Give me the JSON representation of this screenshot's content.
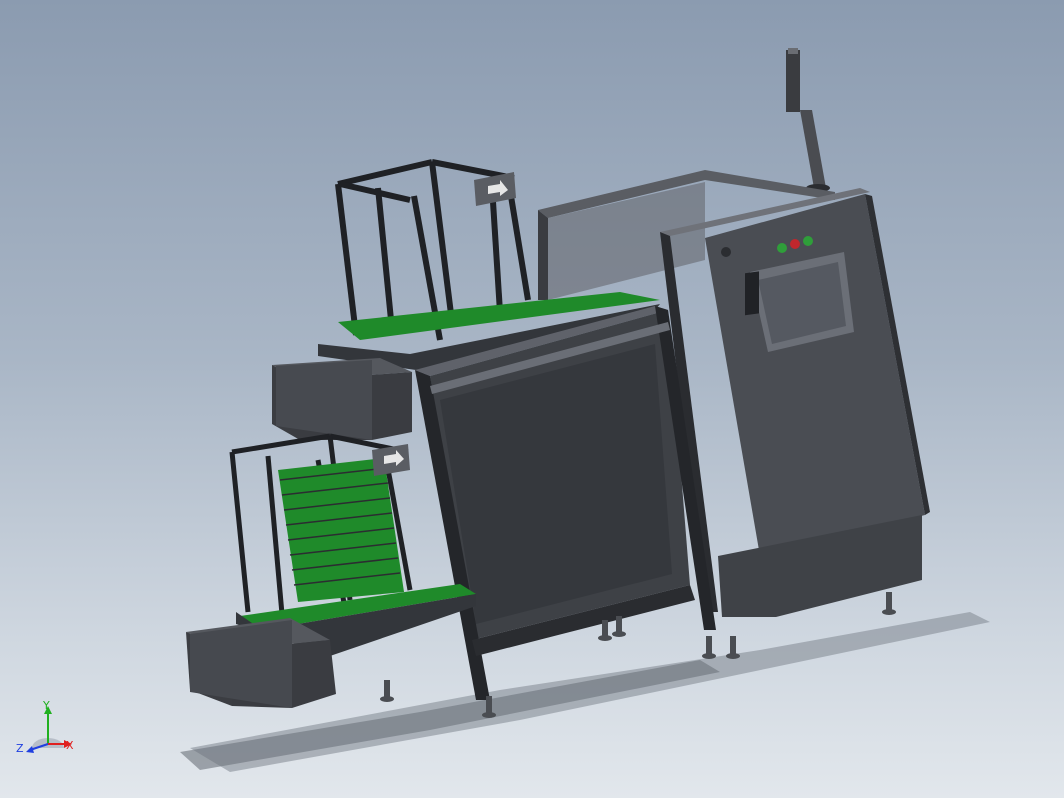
{
  "viewport": {
    "name": "3D model view"
  },
  "colors": {
    "background_top": "#8b9bb0",
    "background_bottom": "#e2e7ec",
    "frame_dark": "#2b2d31",
    "panel": "#3e4045",
    "panel_light": "#55585e",
    "conveyor_green": "#1f8a2a",
    "hmi_screen": "#5a5e66",
    "lamp_green": "#2f9e3a",
    "lamp_red": "#c0272d",
    "axis_x": "#e02020",
    "axis_y": "#20b020",
    "axis_z": "#2040e0"
  },
  "triad": {
    "x_label": "X",
    "y_label": "Y",
    "z_label": "Z"
  }
}
